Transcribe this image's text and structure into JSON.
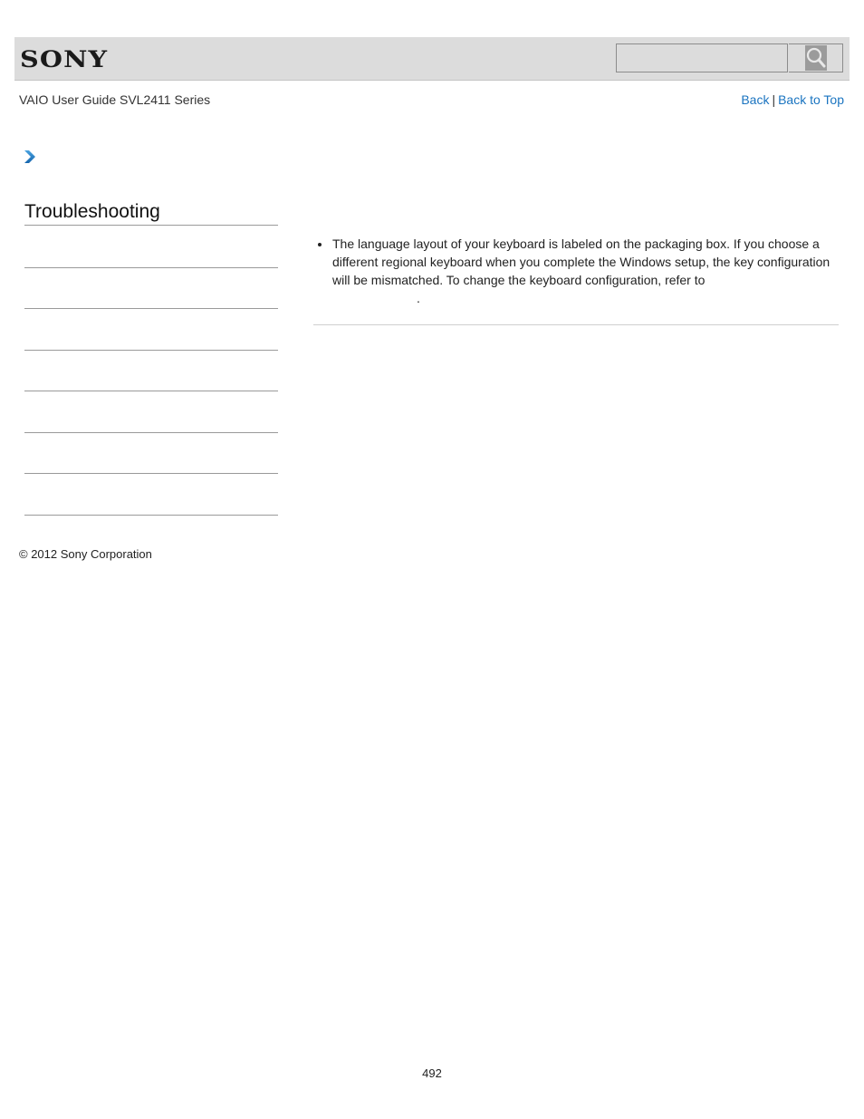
{
  "header": {
    "brand": "SONY",
    "search": {
      "value": "",
      "placeholder": ""
    },
    "search_icon": "magnifier-icon"
  },
  "guide_title": "VAIO User Guide SVL2411 Series",
  "topnav": {
    "back_label": "Back",
    "separator": "|",
    "back_to_top_label": "Back to Top"
  },
  "breadcrumb": {
    "icon": "chevron-right-icon",
    "accent_color": "#1a74c0"
  },
  "sidebar": {
    "title": "Troubleshooting",
    "items": [
      "",
      "",
      "",
      "",
      "",
      "",
      ""
    ]
  },
  "content": {
    "bullets": [
      {
        "text": "The language layout of your keyboard is labeled on the packaging box. If you choose a different regional keyboard when you complete the Windows setup, the key configuration will be mismatched. To change the keyboard configuration, refer to",
        "link_text": "",
        "trailing": "."
      }
    ]
  },
  "footer": {
    "copyright": "© 2012 Sony Corporation",
    "page_number": "492"
  },
  "colors": {
    "header_bg": "#dcdcdc",
    "link": "#1a74c0",
    "rule": "#9a9a9a"
  }
}
